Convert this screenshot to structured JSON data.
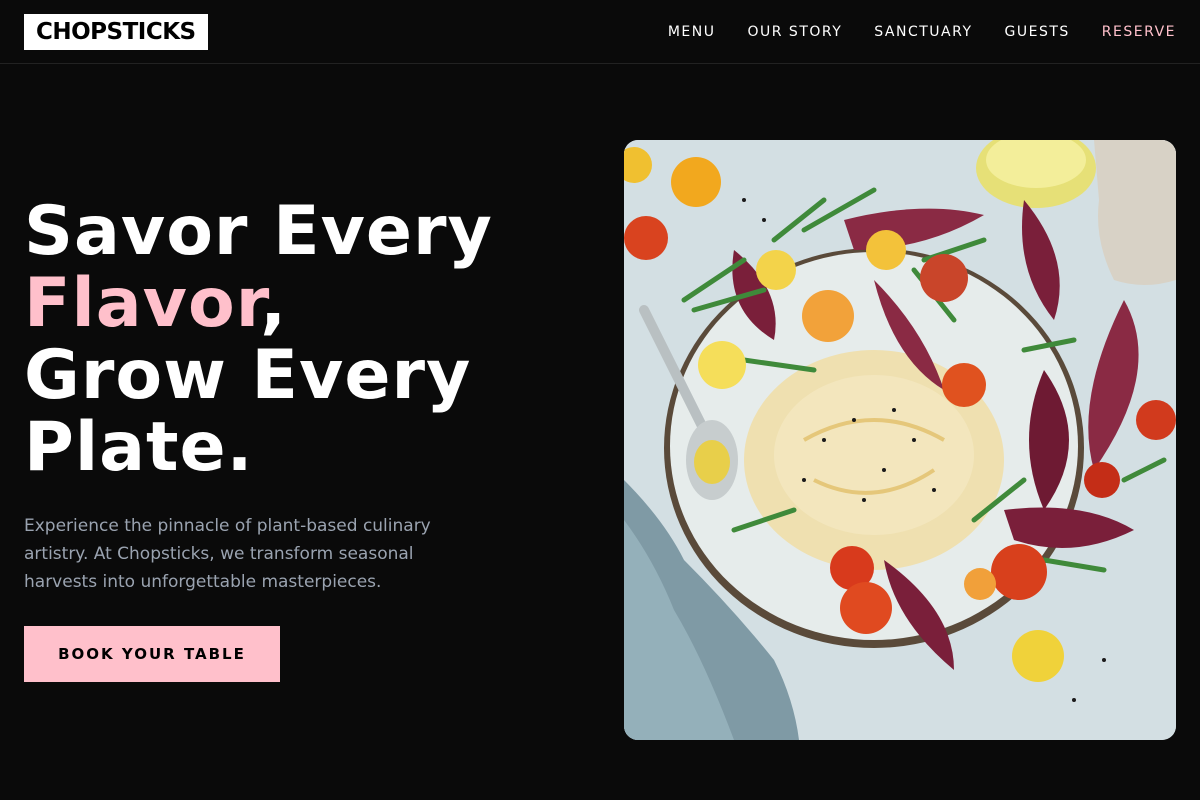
{
  "brand": {
    "logo": "CHOPSTICKS"
  },
  "nav": {
    "items": [
      {
        "label": "MENU"
      },
      {
        "label": "OUR STORY"
      },
      {
        "label": "SANCTUARY"
      },
      {
        "label": "GUESTS"
      },
      {
        "label": "RESERVE"
      }
    ]
  },
  "hero": {
    "headline_line1": "Savor Every",
    "headline_accent": "Flavor",
    "headline_comma": ",",
    "headline_line3": "Grow Every",
    "headline_line4": "Plate.",
    "description": "Experience the pinnacle of plant-based culinary artistry. At Chopsticks, we transform seasonal harvests into unforgettable masterpieces.",
    "cta_label": "BOOK YOUR TABLE"
  },
  "colors": {
    "background": "#0a0a0a",
    "accent_pink": "#ffc0cb",
    "muted_text": "#9aa3b0"
  },
  "image": {
    "subject": "hummus-salad-plate-photo"
  }
}
